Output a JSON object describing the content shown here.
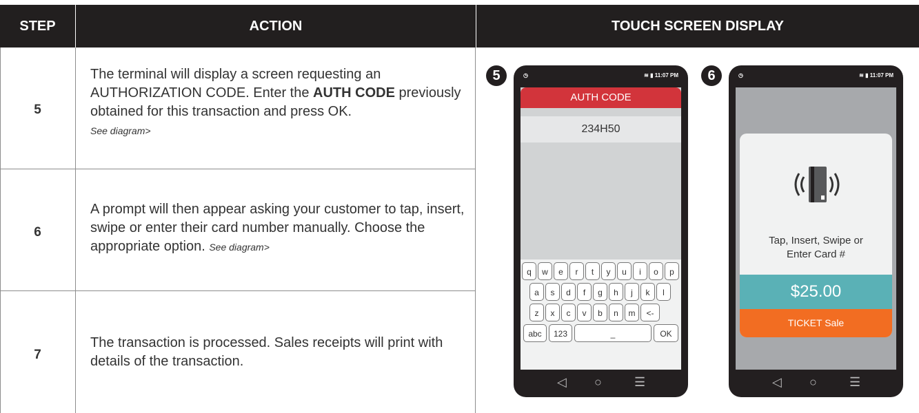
{
  "header": {
    "step": "STEP",
    "action": "ACTION",
    "display": "TOUCH SCREEN DISPLAY"
  },
  "rows": [
    {
      "step": "5",
      "text": "The terminal will display a screen requesting an AUTHORIZATION CODE. Enter the ",
      "bold": "AUTH CODE",
      "text2": " previously obtained for this transaction and press OK.",
      "see": "See diagram>"
    },
    {
      "step": "6",
      "text": "A prompt will then appear asking your customer to tap, insert, swipe or enter their card number manually. Choose the appropriate option. ",
      "see": "See diagram>"
    },
    {
      "step": "7",
      "text": "The transaction is processed. Sales receipts will print with details of the transaction."
    }
  ],
  "phone5": {
    "badge": "5",
    "time": "11:07 PM",
    "title": "AUTH CODE",
    "code": "234H50",
    "keys_row1": [
      "q",
      "w",
      "e",
      "r",
      "t",
      "y",
      "u",
      "i",
      "o",
      "p"
    ],
    "keys_row2": [
      "a",
      "s",
      "d",
      "f",
      "g",
      "h",
      "j",
      "k",
      "l"
    ],
    "keys_row3": [
      "z",
      "x",
      "c",
      "v",
      "b",
      "n",
      "m",
      "<-"
    ],
    "key_abc": "abc",
    "key_123": "123",
    "key_space": "_",
    "key_ok": "OK"
  },
  "phone6": {
    "badge": "6",
    "time": "11:07 PM",
    "prompt_line1": "Tap, Insert, Swipe or",
    "prompt_line2": "Enter Card #",
    "amount": "$25.00",
    "sale": "TICKET Sale"
  },
  "nav": {
    "back": "◁",
    "home": "○",
    "menu": "☰"
  },
  "colors": {
    "header_bg": "#221f1f",
    "red": "#d2343b",
    "teal": "#5ab1b6",
    "orange": "#f26d22",
    "phone": "#231f20"
  }
}
